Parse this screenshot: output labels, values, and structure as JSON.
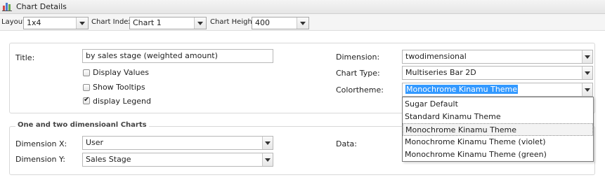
{
  "header": {
    "title": "Chart Details",
    "icon": "bar-chart-icon"
  },
  "toolbar": {
    "layout_label": "Layout",
    "layout_value": "1x4",
    "chart_index_label": "Chart Index",
    "chart_index_value": "Chart 1",
    "chart_height_label": "Chart Height",
    "chart_height_value": "400"
  },
  "main": {
    "title_label": "Title:",
    "title_value": "by sales stage (weighted amount)",
    "checkboxes": [
      {
        "label": "Display Values",
        "checked": false
      },
      {
        "label": "Show Tooltips",
        "checked": false
      },
      {
        "label": "display Legend",
        "checked": true
      }
    ],
    "dimension_label": "Dimension:",
    "dimension_value": "twodimensional",
    "chart_type_label": "Chart Type:",
    "chart_type_value": "Multiseries Bar 2D",
    "colortheme_label": "Colortheme:",
    "colortheme_value": "Monochrome Kinamu Theme",
    "colortheme_options": [
      "Sugar Default",
      "Standard Kinamu Theme",
      "Monochrome Kinamu Theme",
      "Monochrome Kinamu Theme (violet)",
      "Monochrome Kinamu Theme (green)"
    ]
  },
  "dims": {
    "legend": "One and two dimensioanl Charts",
    "dimension_x_label": "Dimension X:",
    "dimension_x_value": "User",
    "dimension_y_label": "Dimension Y:",
    "dimension_y_value": "Sales Stage",
    "data_label": "Data:"
  },
  "colors": {
    "selection": "#3399ff",
    "panel_border": "#d8d8d8"
  }
}
